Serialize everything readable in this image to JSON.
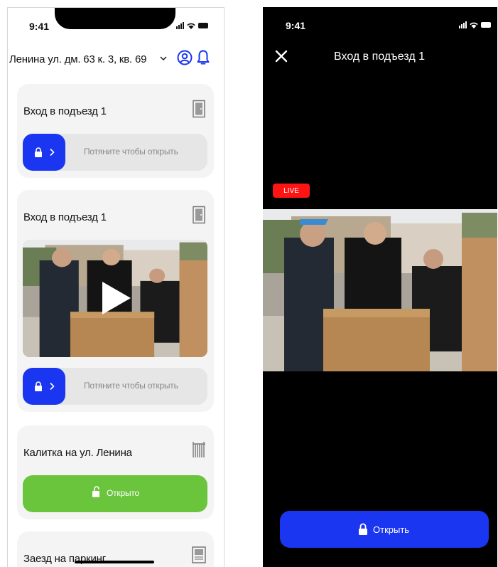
{
  "left_screen": {
    "status_bar": {
      "time": "9:41"
    },
    "address": "Ленина ул. дм. 63 к. 3, кв. 69",
    "cards": [
      {
        "title": "Вход в подъезд 1",
        "slider_label": "Потяните чтобы открыть"
      },
      {
        "title": "Вход в подъезд 1",
        "slider_label": "Потяните чтобы открыть"
      },
      {
        "title": "Калитка на ул. Ленина",
        "button_label": "Открыто"
      },
      {
        "title": "Заезд на паркинг"
      }
    ]
  },
  "right_screen": {
    "status_bar": {
      "time": "9:41"
    },
    "title": "Вход в подъезд 1",
    "live_label": "LIVE",
    "open_button_label": "Открыть"
  },
  "colors": {
    "primary_blue": "#1a36f0",
    "success_green": "#6ac43c",
    "live_red": "#ff1414",
    "card_bg": "#f4f4f4"
  },
  "icons": [
    "chevron-down-icon",
    "profile-icon",
    "bell-icon",
    "door-icon",
    "lock-icon",
    "play-icon",
    "gate-icon",
    "unlock-icon",
    "parking-icon",
    "close-icon"
  ]
}
